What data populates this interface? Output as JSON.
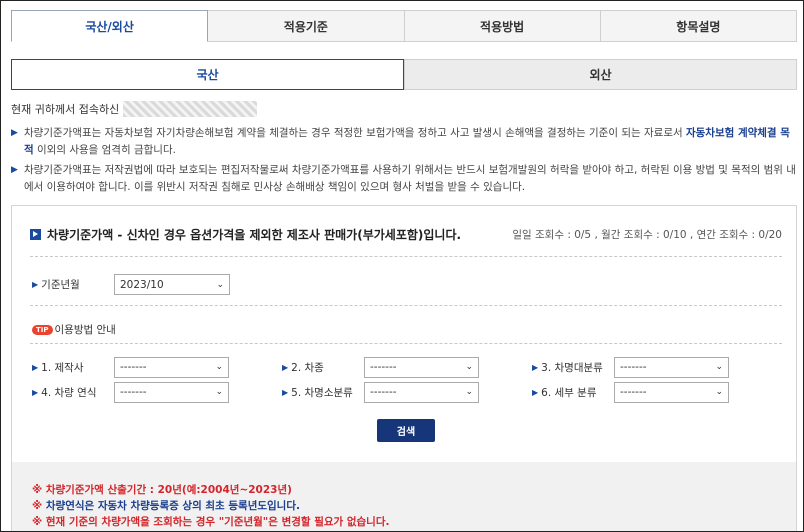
{
  "top_tabs": [
    "국산/외산",
    "적용기준",
    "적용방법",
    "항목설명"
  ],
  "sub_tabs": [
    "국산",
    "외산"
  ],
  "access_prefix": "현재 귀하께서 접속하신",
  "notices": {
    "n1_a": "차량기준가액표는 자동차보험 자기차량손해보험 계약을 체결하는 경우 적정한 보험가액을 정하고 사고 발생시 손해액을 결정하는 기준이 되는 자료로서 ",
    "n1_hl": "자동차보험 계약체결 목적",
    "n1_b": " 이외의 사용을 엄격히 금합니다.",
    "n2": "차량기준가액표는 저작권법에 따라 보호되는 편집저작물로써 차량기준가액표를 사용하기 위해서는 반드시 보험개발원의 허락을 받아야 하고, 허락된 이용 방법 및 목적의 범위 내에서 이용하여야 합니다. 이를 위반시 저작권 침해로 민사상 손해배상 책임이 있으며 형사 처벌을 받을 수 있습니다."
  },
  "panel": {
    "title": "차량기준가액 - 신차인 경우 옵션가격을 제외한 제조사 판매가(부가세포함)입니다.",
    "counts": "일일 조회수 : 0/5 , 월간 조회수 : 0/10 , 연간 조회수 : 0/20",
    "base_label": "기준년월",
    "base_value": "2023/10",
    "tip_badge": "TIP",
    "tip_label": "이용방법 안내",
    "fields": [
      {
        "label": "1. 제작사",
        "value": "-------"
      },
      {
        "label": "2. 차종",
        "value": "-------"
      },
      {
        "label": "3. 차명대분류",
        "value": "-------"
      },
      {
        "label": "4. 차량 연식",
        "value": "-------"
      },
      {
        "label": "5. 차명소분류",
        "value": "-------"
      },
      {
        "label": "6. 세부 분류",
        "value": "-------"
      }
    ],
    "search_label": "검색"
  },
  "footer": {
    "f1": "※ 차량기준가액 산출기간 : 20년(예:2004년~2023년)",
    "f2_mark": "※",
    "f2": " 차량연식은 자동차 차량등록증 상의 최초 등록년도입니다.",
    "f3": "※ 현재 기준의 차량가액을 조회하는 경우 \"기준년월\"은 변경할 필요가 없습니다."
  },
  "colors": {
    "accent": "#1a4aa0",
    "button": "#17367a",
    "warn": "#d3252b"
  }
}
